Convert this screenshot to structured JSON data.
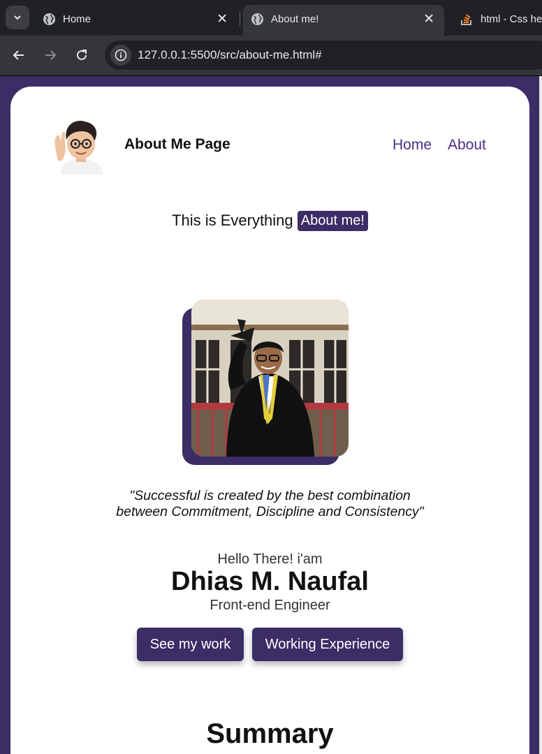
{
  "browser": {
    "tabs": [
      {
        "title": "Home",
        "icon": "globe-icon"
      },
      {
        "title": "About me!",
        "icon": "globe-icon",
        "active": true
      },
      {
        "title": "html - Css hei",
        "icon": "stackoverflow-icon"
      }
    ],
    "url": "127.0.0.1:5500/src/about-me.html#"
  },
  "header": {
    "site_title": "About Me Page",
    "nav": [
      "Home",
      "About"
    ]
  },
  "hero": {
    "tagline_prefix": "This is Everything",
    "tagline_badge": "About me!",
    "quote_line1": "\"Successful is created by the best combination",
    "quote_line2": "between Commitment, Discipline and Consistency\"",
    "greeting": "Hello There! i'am",
    "name": "Dhias M. Naufal",
    "role": "Front-end Engineer",
    "buttons": [
      "See my work",
      "Working Experience"
    ]
  },
  "summary": {
    "heading": "Summary"
  },
  "colors": {
    "brand": "#3b2d66",
    "link": "#4a2f86",
    "chrome_dark": "#202124",
    "chrome_toolbar": "#35363a"
  }
}
